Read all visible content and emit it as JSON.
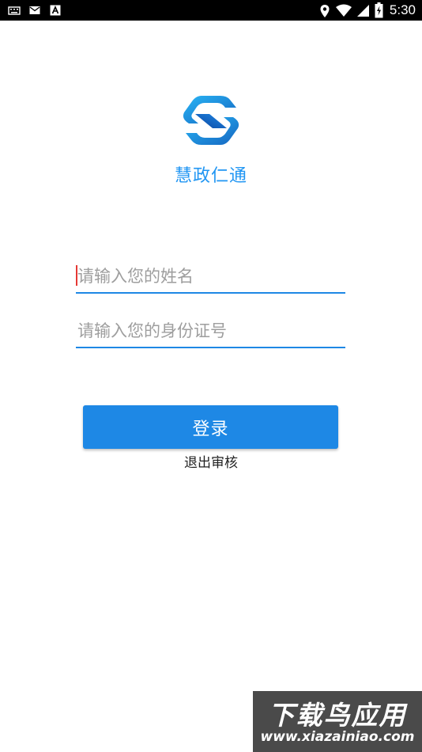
{
  "status_bar": {
    "time": "5:30",
    "left_icons": [
      "keyboard-icon",
      "mail-icon",
      "a-notification-icon"
    ],
    "right_icons": [
      "location-icon",
      "wifi-icon",
      "signal-icon",
      "battery-charging-icon"
    ]
  },
  "app": {
    "title": "慧政仁通",
    "accent_color": "#1E88E5"
  },
  "form": {
    "name_placeholder": "请输入您的姓名",
    "name_value": "",
    "id_placeholder": "请输入您的身份证号",
    "id_value": ""
  },
  "actions": {
    "login_label": "登录",
    "exit_label": "退出审核"
  },
  "watermark": {
    "title": "下载鸟应用",
    "url": "www.xiazainiao.com"
  }
}
